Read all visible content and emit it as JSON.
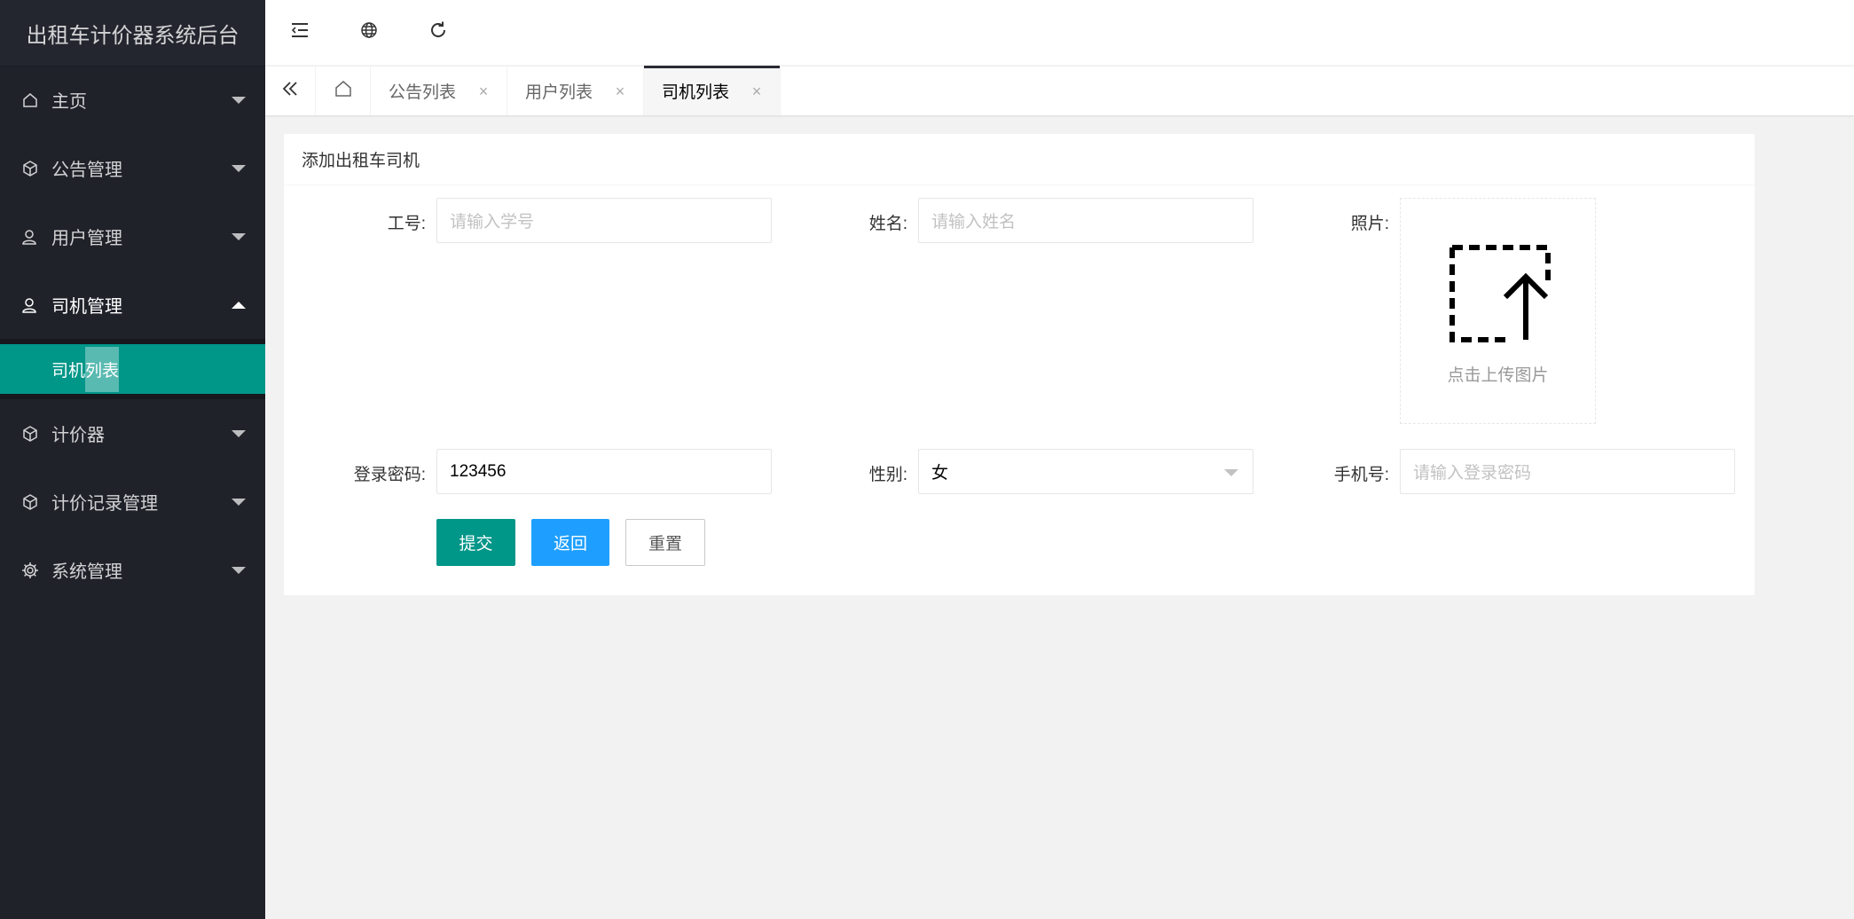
{
  "app": {
    "title": "出租车计价器系统后台"
  },
  "sidebar": {
    "items": [
      {
        "label": "主页",
        "icon": "home-icon"
      },
      {
        "label": "公告管理",
        "icon": "cube-icon"
      },
      {
        "label": "用户管理",
        "icon": "user-icon"
      },
      {
        "label": "司机管理",
        "icon": "user-icon",
        "expanded": true,
        "children": [
          {
            "label_a": "司机",
            "label_b": "列表"
          }
        ]
      },
      {
        "label": "计价器",
        "icon": "cube-icon"
      },
      {
        "label": "计价记录管理",
        "icon": "cube-icon"
      },
      {
        "label": "系统管理",
        "icon": "gear-icon"
      }
    ],
    "active_color": "#009688"
  },
  "header": {
    "icons": [
      "menu-fold-icon",
      "globe-icon",
      "refresh-icon"
    ]
  },
  "tabs": {
    "items": [
      {
        "label": "公告列表",
        "close": "×"
      },
      {
        "label": "用户列表",
        "close": "×"
      },
      {
        "label": "司机列表",
        "close": "×",
        "active": true
      }
    ]
  },
  "form": {
    "title": "添加出租车司机",
    "fields": {
      "job_no": {
        "label": "工号:",
        "placeholder": "请输入学号",
        "value": ""
      },
      "name": {
        "label": "姓名:",
        "placeholder": "请输入姓名",
        "value": ""
      },
      "photo": {
        "label": "照片:",
        "upload_text": "点击上传图片"
      },
      "password": {
        "label": "登录密码:",
        "value": "123456"
      },
      "gender": {
        "label": "性别:",
        "value": "女"
      },
      "phone": {
        "label": "手机号:",
        "placeholder": "请输入登录密码",
        "value": ""
      }
    },
    "buttons": {
      "submit": "提交",
      "back": "返回",
      "reset": "重置"
    }
  },
  "colors": {
    "primary": "#009688",
    "blue": "#1e9fff",
    "sidebar_bg": "#20222a"
  }
}
